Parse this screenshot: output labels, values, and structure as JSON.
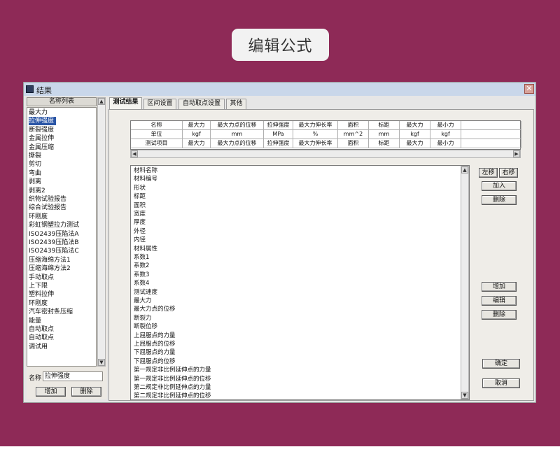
{
  "banner": {
    "title": "编辑公式"
  },
  "window": {
    "title": "结果"
  },
  "left_panel": {
    "header": "名称列表",
    "items": [
      "最大力",
      "拉伸强度",
      "断裂强度",
      "金属拉伸",
      "金属压缩",
      "撕裂",
      "剪切",
      "弯曲",
      "剥离",
      "剥离2",
      "织物试验报告",
      "综合试验报告",
      "环刚度",
      "彩虹钢塑拉力测试",
      "ISO2439压陷法A",
      "ISO2439压陷法B",
      "ISO2439压陷法C",
      "压缩海绵方法1",
      "压缩海绵方法2",
      "手动取点",
      "上下限",
      "塑料拉伸",
      "环刚度",
      "汽车密封条压缩",
      "能量",
      "自动取点",
      "自动取点",
      "调试用"
    ],
    "selected_index": 1,
    "name_label": "名称",
    "name_value": "拉伸强度",
    "add_button": "增加",
    "delete_button": "删除"
  },
  "tabs": [
    "测试结果",
    "区间设置",
    "自动取点设置",
    "其他"
  ],
  "active_tab": 0,
  "grid": {
    "rows": [
      [
        "名称",
        "最大力",
        "最大力点的位移",
        "拉伸强度",
        "最大力伸长率",
        "面积",
        "标距",
        "最大力",
        "最小力",
        ""
      ],
      [
        "单位",
        "kgf",
        "mm",
        "MPa",
        "%",
        "mm^2",
        "mm",
        "kgf",
        "kgf",
        ""
      ],
      [
        "测试项目",
        "最大力",
        "最大力点的位移",
        "拉伸强度",
        "最大力伸长率",
        "面积",
        "标距",
        "最大力",
        "最小力",
        ""
      ]
    ]
  },
  "field_list": [
    "材料名称",
    "材料编号",
    "形状",
    "标距",
    "面积",
    "宽度",
    "厚度",
    "外径",
    "内径",
    "材料属性",
    "系数1",
    "系数2",
    "系数3",
    "系数4",
    "测试速度",
    "最大力",
    "最大力点的位移",
    "断裂力",
    "断裂位移",
    "上屈服点的力量",
    "上屈服点的位移",
    "下屈服点的力量",
    "下屈服点的位移",
    "第一规定非比例延伸点的力量",
    "第一规定非比例延伸点的位移",
    "第二规定非比例延伸点的力量",
    "第二规定非比例延伸点的位移"
  ],
  "buttons": {
    "move_left": "左移",
    "move_right": "右移",
    "add": "加入",
    "remove": "删除",
    "increase": "增加",
    "edit": "编辑",
    "delete": "删除",
    "ok": "确定",
    "cancel": "取消"
  },
  "colors": {
    "background": "#8e2a57",
    "selection": "#2b56a6"
  }
}
